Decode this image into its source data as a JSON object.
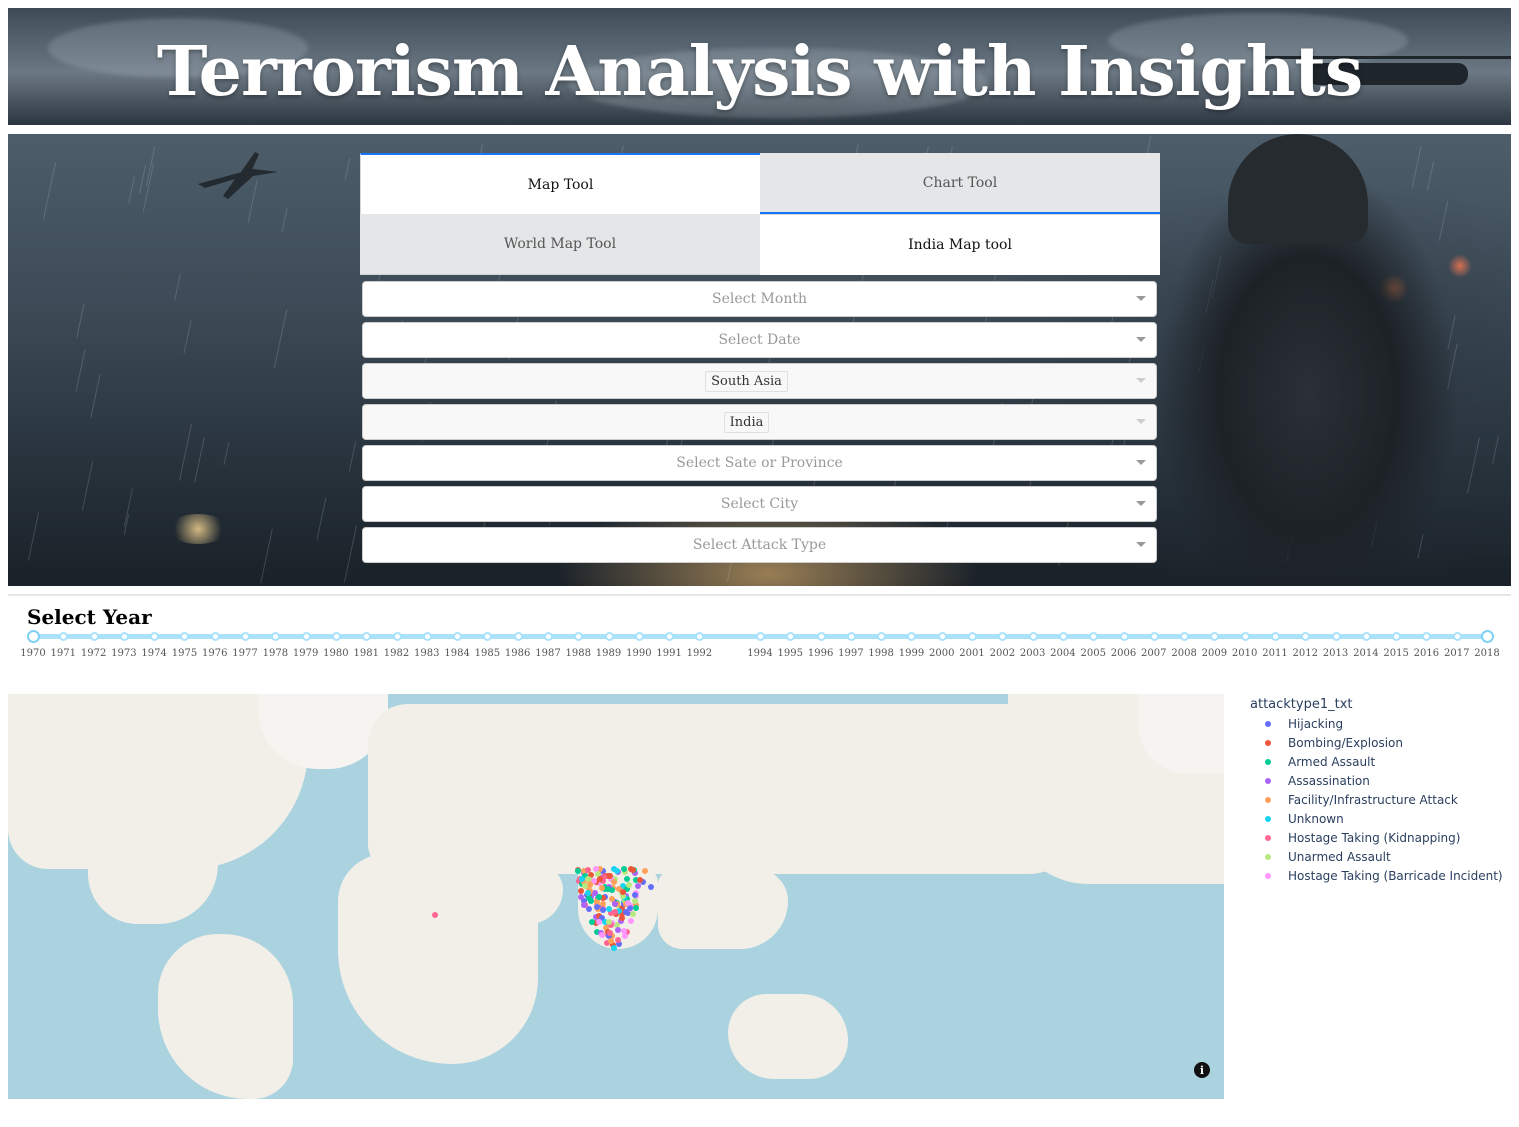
{
  "header": {
    "title": "Terrorism Analysis with Insights"
  },
  "tabs": {
    "main": [
      {
        "label": "Map Tool",
        "active": true
      },
      {
        "label": "Chart Tool",
        "active": false
      }
    ],
    "sub": [
      {
        "label": "World Map Tool",
        "active": false
      },
      {
        "label": "India Map tool",
        "active": true
      }
    ]
  },
  "filters": {
    "month": {
      "placeholder": "Select Month"
    },
    "date": {
      "placeholder": "Select Date"
    },
    "region": {
      "value": "South Asia",
      "disabled": true
    },
    "country": {
      "value": "India",
      "disabled": true
    },
    "state": {
      "placeholder": "Select Sate or Province"
    },
    "city": {
      "placeholder": "Select City"
    },
    "attack_type": {
      "placeholder": "Select Attack Type"
    }
  },
  "year_slider": {
    "title": "Select Year",
    "min": 1970,
    "max": 2018,
    "selected_range": [
      1970,
      2018
    ],
    "years": [
      "1970",
      "1971",
      "1972",
      "1973",
      "1974",
      "1975",
      "1976",
      "1977",
      "1978",
      "1979",
      "1980",
      "1981",
      "1982",
      "1983",
      "1984",
      "1985",
      "1986",
      "1987",
      "1988",
      "1989",
      "1990",
      "1991",
      "1992",
      "1994",
      "1995",
      "1996",
      "1997",
      "1998",
      "1999",
      "2000",
      "2001",
      "2002",
      "2003",
      "2004",
      "2005",
      "2006",
      "2007",
      "2008",
      "2009",
      "2010",
      "2011",
      "2012",
      "2013",
      "2014",
      "2015",
      "2016",
      "2017",
      "2018"
    ]
  },
  "map": {
    "legend_title": "attacktype1_txt",
    "legend": [
      {
        "label": "Hijacking",
        "color": "#636efa"
      },
      {
        "label": "Bombing/Explosion",
        "color": "#ef553b"
      },
      {
        "label": "Armed Assault",
        "color": "#00cc96"
      },
      {
        "label": "Assassination",
        "color": "#ab63fa"
      },
      {
        "label": "Facility/Infrastructure Attack",
        "color": "#ffa15a"
      },
      {
        "label": "Unknown",
        "color": "#19d3f3"
      },
      {
        "label": "Hostage Taking (Kidnapping)",
        "color": "#ff6692"
      },
      {
        "label": "Unarmed Assault",
        "color": "#b6e880"
      },
      {
        "label": "Hostage Taking (Barricade Incident)",
        "color": "#ff97ff"
      }
    ],
    "info_icon": "info-icon"
  }
}
